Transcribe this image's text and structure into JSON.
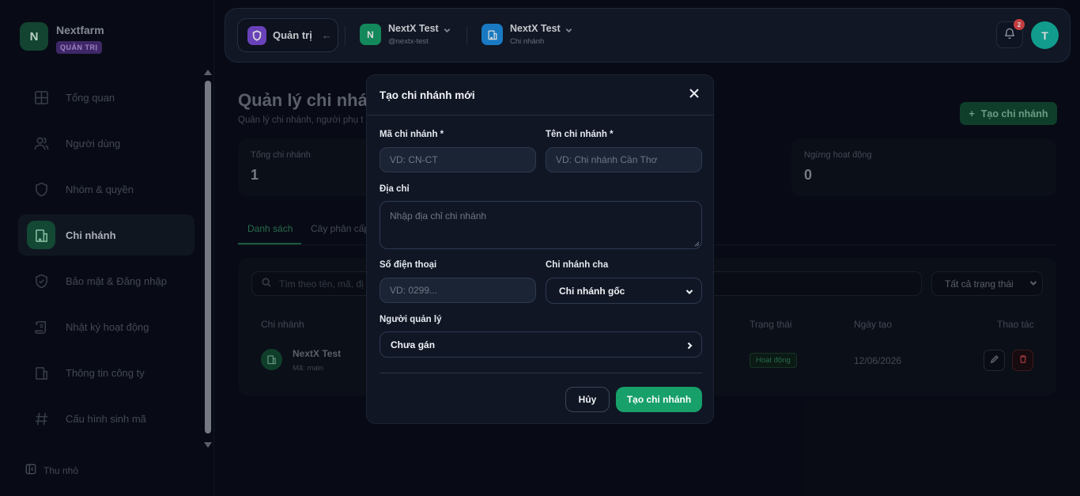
{
  "sidebar": {
    "brand_initial": "N",
    "brand_name": "Nextfarm",
    "brand_badge": "QUẢN TRỊ",
    "items": [
      {
        "label": "Tổng quan",
        "icon": "grid-icon"
      },
      {
        "label": "Người dùng",
        "icon": "users-icon"
      },
      {
        "label": "Nhóm & quyền",
        "icon": "shield-icon"
      },
      {
        "label": "Chi nhánh",
        "icon": "building-icon",
        "active": true
      },
      {
        "label": "Bảo mật & Đăng nhập",
        "icon": "shield-check-icon"
      },
      {
        "label": "Nhật ký hoạt động",
        "icon": "scroll-icon"
      },
      {
        "label": "Thông tin công ty",
        "icon": "company-icon"
      },
      {
        "label": "Cấu hình sinh mã",
        "icon": "hash-icon"
      }
    ],
    "collapse_label": "Thu nhỏ"
  },
  "topbar": {
    "admin_label": "Quản trị",
    "org": {
      "initial": "N",
      "name": "NextX Test",
      "handle": "@nextx-test"
    },
    "branch": {
      "name": "NextX Test",
      "sub": "Chi nhánh"
    },
    "notification_count": "2",
    "user_initial": "T"
  },
  "page": {
    "title": "Quản lý chi nhánh",
    "subtitle": "Quản lý chi nhánh, người phụ t",
    "create_button": "Tạo chi nhánh",
    "stats": [
      {
        "label": "Tổng chi nhánh",
        "value": "1"
      },
      {
        "label": "Ngừng hoạt động",
        "value": "0"
      }
    ],
    "tabs": [
      "Danh sách",
      "Cây phân cấp"
    ],
    "search_placeholder": "Tìm theo tên, mã, đị",
    "status_filter": "Tất cả trạng thái",
    "columns": {
      "branch": "Chi nhánh",
      "status": "Trạng thái",
      "created": "Ngày tạo",
      "actions": "Thao tác"
    },
    "rows": [
      {
        "name": "NextX Test",
        "code": "Mã: main",
        "status": "Hoạt động",
        "created": "12/06/2026"
      }
    ]
  },
  "modal": {
    "title": "Tạo chi nhánh mới",
    "code_label": "Mã chi nhánh *",
    "code_placeholder": "VD: CN-CT",
    "name_label": "Tên chi nhánh *",
    "name_placeholder": "VD: Chi nhánh Cần Thơ",
    "address_label": "Địa chỉ",
    "address_placeholder": "Nhập địa chỉ chi nhánh",
    "phone_label": "Số điện thoại",
    "phone_placeholder": "VD: 0299...",
    "parent_label": "Chi nhánh cha",
    "parent_value": "Chi nhánh gốc",
    "manager_label": "Người quản lý",
    "manager_value": "Chưa gán",
    "cancel_label": "Hủy",
    "submit_label": "Tạo chi nhánh"
  },
  "colors": {
    "accent": "#17a06a",
    "admin_purple": "#7c4ddb",
    "branch_blue": "#1e90e6",
    "user_teal": "#14b8a6",
    "danger": "#e5484d"
  }
}
